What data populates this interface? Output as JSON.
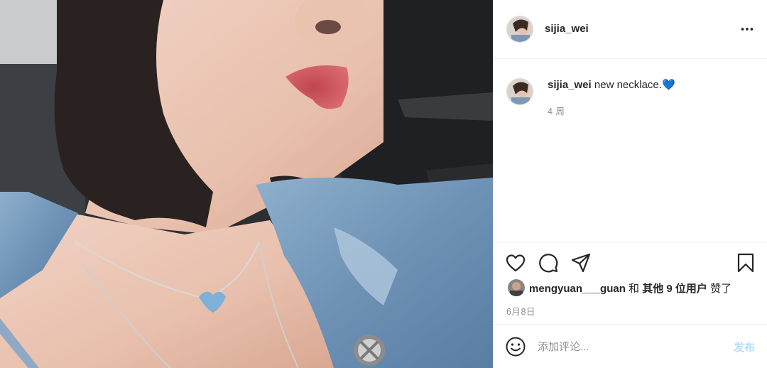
{
  "post": {
    "author": "sijia_wei",
    "caption_text": "new necklace.",
    "caption_emoji": "💙",
    "time_ago": "4 周",
    "liked_by_user": "mengyuan___guan",
    "likes_connector": "和",
    "likes_others": "其他 9 位用户",
    "likes_suffix": "赞了",
    "date": "6月8日"
  },
  "comment": {
    "placeholder": "添加评论...",
    "post_label": "发布"
  },
  "icons": {
    "more": "more-horizontal-icon",
    "like": "heart-icon",
    "comment": "comment-bubble-icon",
    "share": "paper-plane-icon",
    "save": "bookmark-icon",
    "emoji": "smiley-icon"
  },
  "colors": {
    "post_button_disabled": "#b2dffc",
    "secondary_text": "#8e8e8e",
    "divider": "#efefef"
  }
}
